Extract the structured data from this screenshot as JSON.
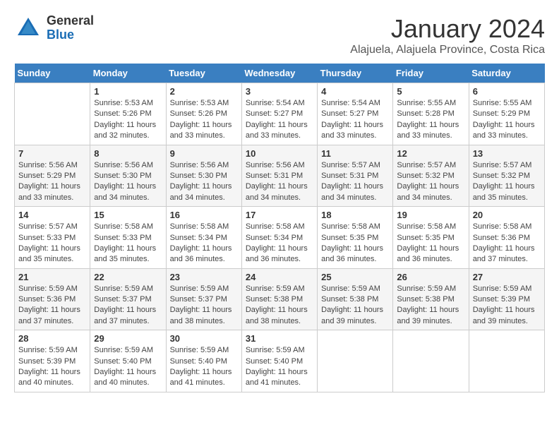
{
  "header": {
    "logo_general": "General",
    "logo_blue": "Blue",
    "month_title": "January 2024",
    "location": "Alajuela, Alajuela Province, Costa Rica"
  },
  "weekdays": [
    "Sunday",
    "Monday",
    "Tuesday",
    "Wednesday",
    "Thursday",
    "Friday",
    "Saturday"
  ],
  "weeks": [
    [
      {
        "day": "",
        "info": ""
      },
      {
        "day": "1",
        "info": "Sunrise: 5:53 AM\nSunset: 5:26 PM\nDaylight: 11 hours\nand 32 minutes."
      },
      {
        "day": "2",
        "info": "Sunrise: 5:53 AM\nSunset: 5:26 PM\nDaylight: 11 hours\nand 33 minutes."
      },
      {
        "day": "3",
        "info": "Sunrise: 5:54 AM\nSunset: 5:27 PM\nDaylight: 11 hours\nand 33 minutes."
      },
      {
        "day": "4",
        "info": "Sunrise: 5:54 AM\nSunset: 5:27 PM\nDaylight: 11 hours\nand 33 minutes."
      },
      {
        "day": "5",
        "info": "Sunrise: 5:55 AM\nSunset: 5:28 PM\nDaylight: 11 hours\nand 33 minutes."
      },
      {
        "day": "6",
        "info": "Sunrise: 5:55 AM\nSunset: 5:29 PM\nDaylight: 11 hours\nand 33 minutes."
      }
    ],
    [
      {
        "day": "7",
        "info": ""
      },
      {
        "day": "8",
        "info": "Sunrise: 5:56 AM\nSunset: 5:30 PM\nDaylight: 11 hours\nand 34 minutes."
      },
      {
        "day": "9",
        "info": "Sunrise: 5:56 AM\nSunset: 5:30 PM\nDaylight: 11 hours\nand 34 minutes."
      },
      {
        "day": "10",
        "info": "Sunrise: 5:56 AM\nSunset: 5:31 PM\nDaylight: 11 hours\nand 34 minutes."
      },
      {
        "day": "11",
        "info": "Sunrise: 5:57 AM\nSunset: 5:31 PM\nDaylight: 11 hours\nand 34 minutes."
      },
      {
        "day": "12",
        "info": "Sunrise: 5:57 AM\nSunset: 5:32 PM\nDaylight: 11 hours\nand 34 minutes."
      },
      {
        "day": "13",
        "info": "Sunrise: 5:57 AM\nSunset: 5:32 PM\nDaylight: 11 hours\nand 35 minutes."
      }
    ],
    [
      {
        "day": "14",
        "info": ""
      },
      {
        "day": "15",
        "info": "Sunrise: 5:58 AM\nSunset: 5:33 PM\nDaylight: 11 hours\nand 35 minutes."
      },
      {
        "day": "16",
        "info": "Sunrise: 5:58 AM\nSunset: 5:34 PM\nDaylight: 11 hours\nand 36 minutes."
      },
      {
        "day": "17",
        "info": "Sunrise: 5:58 AM\nSunset: 5:34 PM\nDaylight: 11 hours\nand 36 minutes."
      },
      {
        "day": "18",
        "info": "Sunrise: 5:58 AM\nSunset: 5:35 PM\nDaylight: 11 hours\nand 36 minutes."
      },
      {
        "day": "19",
        "info": "Sunrise: 5:58 AM\nSunset: 5:35 PM\nDaylight: 11 hours\nand 36 minutes."
      },
      {
        "day": "20",
        "info": "Sunrise: 5:58 AM\nSunset: 5:36 PM\nDaylight: 11 hours\nand 37 minutes."
      }
    ],
    [
      {
        "day": "21",
        "info": ""
      },
      {
        "day": "22",
        "info": "Sunrise: 5:59 AM\nSunset: 5:37 PM\nDaylight: 11 hours\nand 37 minutes."
      },
      {
        "day": "23",
        "info": "Sunrise: 5:59 AM\nSunset: 5:37 PM\nDaylight: 11 hours\nand 38 minutes."
      },
      {
        "day": "24",
        "info": "Sunrise: 5:59 AM\nSunset: 5:38 PM\nDaylight: 11 hours\nand 38 minutes."
      },
      {
        "day": "25",
        "info": "Sunrise: 5:59 AM\nSunset: 5:38 PM\nDaylight: 11 hours\nand 39 minutes."
      },
      {
        "day": "26",
        "info": "Sunrise: 5:59 AM\nSunset: 5:38 PM\nDaylight: 11 hours\nand 39 minutes."
      },
      {
        "day": "27",
        "info": "Sunrise: 5:59 AM\nSunset: 5:39 PM\nDaylight: 11 hours\nand 39 minutes."
      }
    ],
    [
      {
        "day": "28",
        "info": ""
      },
      {
        "day": "29",
        "info": "Sunrise: 5:59 AM\nSunset: 5:40 PM\nDaylight: 11 hours\nand 40 minutes."
      },
      {
        "day": "30",
        "info": "Sunrise: 5:59 AM\nSunset: 5:40 PM\nDaylight: 11 hours\nand 41 minutes."
      },
      {
        "day": "31",
        "info": "Sunrise: 5:59 AM\nSunset: 5:40 PM\nDaylight: 11 hours\nand 41 minutes."
      },
      {
        "day": "",
        "info": ""
      },
      {
        "day": "",
        "info": ""
      },
      {
        "day": "",
        "info": ""
      }
    ]
  ],
  "week1_day7_info": "Sunrise: 5:55 AM\nSunset: 5:29 PM\nDaylight: 11 hours\nand 33 minutes.",
  "week2_day7_info": "Sunrise: 5:56 AM\nSunset: 5:29 PM\nDaylight: 11 hours\nand 33 minutes.",
  "week3_day14_info": "Sunrise: 5:57 AM\nSunset: 5:33 PM\nDaylight: 11 hours\nand 35 minutes.",
  "week4_day21_info": "Sunrise: 5:59 AM\nSunset: 5:36 PM\nDaylight: 11 hours\nand 37 minutes.",
  "week5_day28_info": "Sunrise: 5:59 AM\nSunset: 5:39 PM\nDaylight: 11 hours\nand 40 minutes."
}
